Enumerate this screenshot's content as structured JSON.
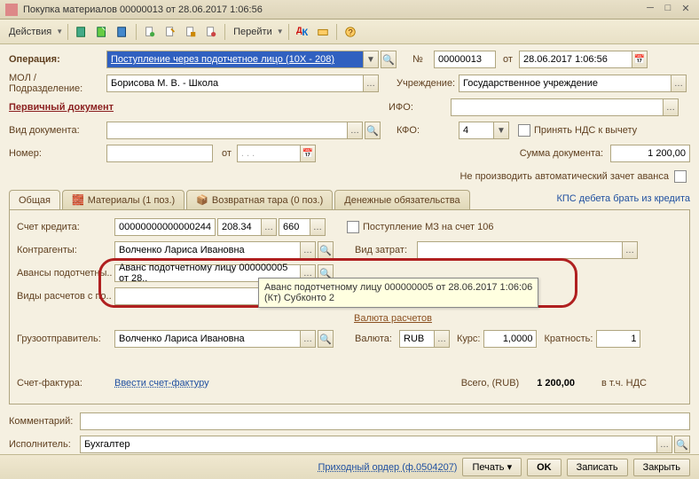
{
  "window": {
    "title": "Покупка материалов 00000013 от 28.06.2017 1:06:56"
  },
  "toolbar": {
    "actions": "Действия",
    "goto": "Перейти"
  },
  "form": {
    "operation_label": "Операция:",
    "operation_value": "Поступление через подотчетное лицо (10Х - 208)",
    "num_label": "№",
    "num_value": "00000013",
    "date_label": "от",
    "date_value": "28.06.2017 1:06:56",
    "mol_label": "МОЛ / Подразделение:",
    "mol_value": "Борисова М. В. - Школа",
    "inst_label": "Учреждение:",
    "inst_value": "Государственное учреждение",
    "primary_doc": "Первичный документ",
    "ifo_label": "ИФО:",
    "doctype_label": "Вид документа:",
    "kfo_label": "КФО:",
    "kfo_value": "4",
    "nds_check": "Принять НДС к вычету",
    "num2_label": "Номер:",
    "ot_label": "от",
    "sum_label": "Сумма документа:",
    "sum_value": "1 200,00",
    "no_offset": "Не производить автоматический зачет аванса"
  },
  "tabs": {
    "t1": "Общая",
    "t2": "Материалы (1 поз.)",
    "t3": "Возвратная тара (0 поз.)",
    "t4": "Денежные обязательства",
    "right": "КПС дебета брать из кредита"
  },
  "general": {
    "credit_account_label": "Счет кредита:",
    "credit_account_value": "00000000000000244",
    "credit_sub1": "208.34",
    "credit_sub2": "660",
    "mz_check": "Поступление МЗ на счет 106",
    "counteragents_label": "Контрагенты:",
    "counteragents_value": "Волченко Лариса Ивановна",
    "cost_type_label": "Вид затрат:",
    "advances_label": "Авансы подотчетны..",
    "advances_value": "Аванс подотчетному лицу 000000005 от 28..",
    "settlement_label": "Виды расчетов с по..",
    "tooltip_line1": "Аванс подотчетному лицу 000000005 от 28.06.2017 1:06:06",
    "tooltip_line2": "(Кт) Субконто 2",
    "currency_hdr": "Валюта расчетов",
    "shipper_label": "Грузоотправитель:",
    "shipper_value": "Волченко Лариса Ивановна",
    "currency_label": "Валюта:",
    "currency_value": "RUB",
    "rate_label": "Курс:",
    "rate_value": "1,0000",
    "mult_label": "Кратность:",
    "mult_value": "1",
    "invoice_label": "Счет-фактура:",
    "invoice_link": "Ввести счет-фактуру",
    "total_label": "Всего, (RUB)",
    "total_value": "1 200,00",
    "vat_label": "в т.ч. НДС"
  },
  "bottom": {
    "comment_label": "Комментарий:",
    "executor_label": "Исполнитель:",
    "executor_value": "Бухгалтер"
  },
  "footer": {
    "order": "Приходный ордер (ф.0504207)",
    "print": "Печать",
    "ok": "OK",
    "save": "Записать",
    "close": "Закрыть"
  }
}
